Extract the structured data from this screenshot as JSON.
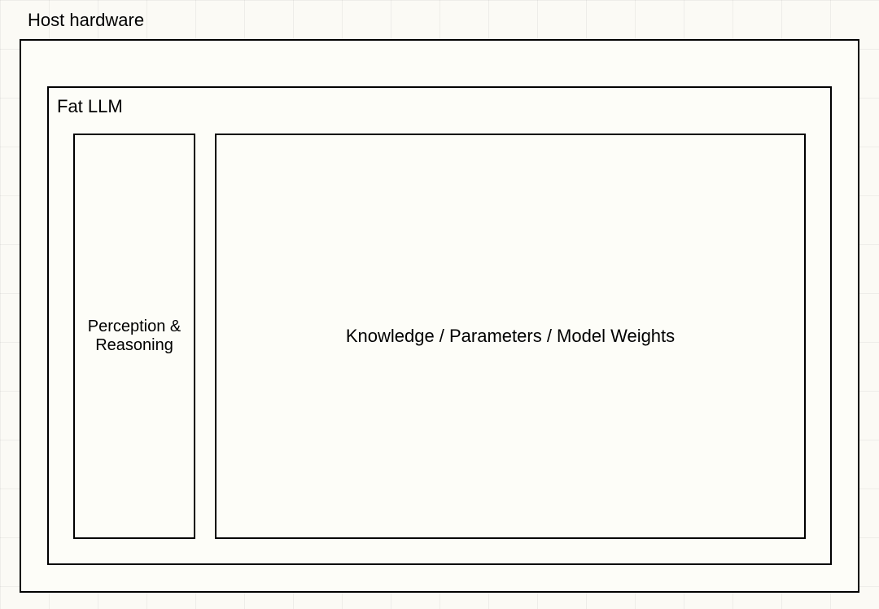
{
  "diagram": {
    "host_hardware_label": "Host hardware",
    "fat_llm_label": "Fat LLM",
    "perception_label": "Perception & Reasoning",
    "knowledge_label": "Knowledge / Parameters / Model Weights"
  }
}
